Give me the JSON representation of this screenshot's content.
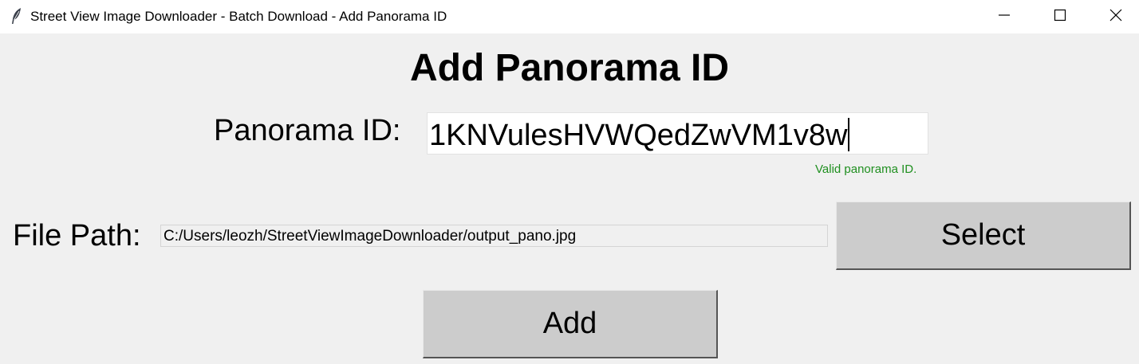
{
  "window": {
    "title": "Street View Image Downloader - Batch Download - Add Panorama ID"
  },
  "dialog": {
    "heading": "Add Panorama ID",
    "panorama_id_label": "Panorama ID:",
    "panorama_id_value": "1KNVulesHVWQedZwVM1v8w",
    "validation_message": "Valid panorama ID.",
    "validation_color": "#1f8f1f",
    "file_path_label": "File Path:",
    "file_path_value": "C:/Users/leozh/StreetViewImageDownloader/output_pano.jpg",
    "select_button": "Select",
    "add_button": "Add"
  },
  "icons": {
    "app": "feather-icon",
    "minimize": "minimize-icon",
    "maximize": "maximize-icon",
    "close": "close-icon"
  }
}
